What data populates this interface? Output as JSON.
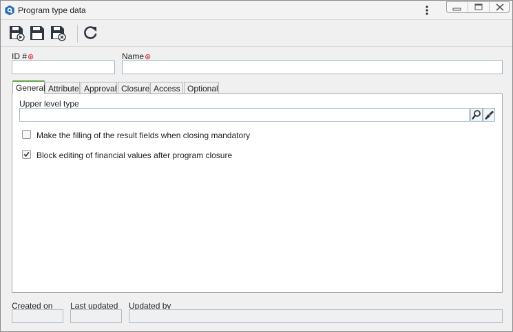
{
  "window": {
    "title": "Program type data"
  },
  "toolbar": {
    "buttons": [
      {
        "name": "save-and-new",
        "icon": "save-new-icon"
      },
      {
        "name": "save",
        "icon": "save-icon"
      },
      {
        "name": "save-and-close",
        "icon": "save-close-icon"
      },
      {
        "name": "refresh",
        "icon": "refresh-icon"
      }
    ]
  },
  "form": {
    "id_label": "ID #",
    "id_value": "",
    "name_label": "Name",
    "name_value": "",
    "required_marker": "⊛"
  },
  "tabs": [
    {
      "label": "General",
      "active": true
    },
    {
      "label": "Attribute",
      "active": false
    },
    {
      "label": "Approval",
      "active": false
    },
    {
      "label": "Closure",
      "active": false
    },
    {
      "label": "Access",
      "active": false
    },
    {
      "label": "Optional",
      "active": false
    }
  ],
  "general": {
    "upper_level_label": "Upper level type",
    "upper_level_value": "",
    "checkboxes": [
      {
        "label": "Make the filling of the result fields when closing mandatory",
        "checked": false
      },
      {
        "label": "Block editing of financial values after program closure",
        "checked": true
      }
    ]
  },
  "footer": {
    "created_label": "Created on",
    "created_value": "",
    "updated_label": "Last updated",
    "updated_value": "",
    "updated_by_label": "Updated by",
    "updated_by_value": ""
  },
  "colors": {
    "accent_tab": "#64a546",
    "required": "#d0202a",
    "icon_dark": "#2f3640",
    "app_icon": "#2a6db5"
  }
}
